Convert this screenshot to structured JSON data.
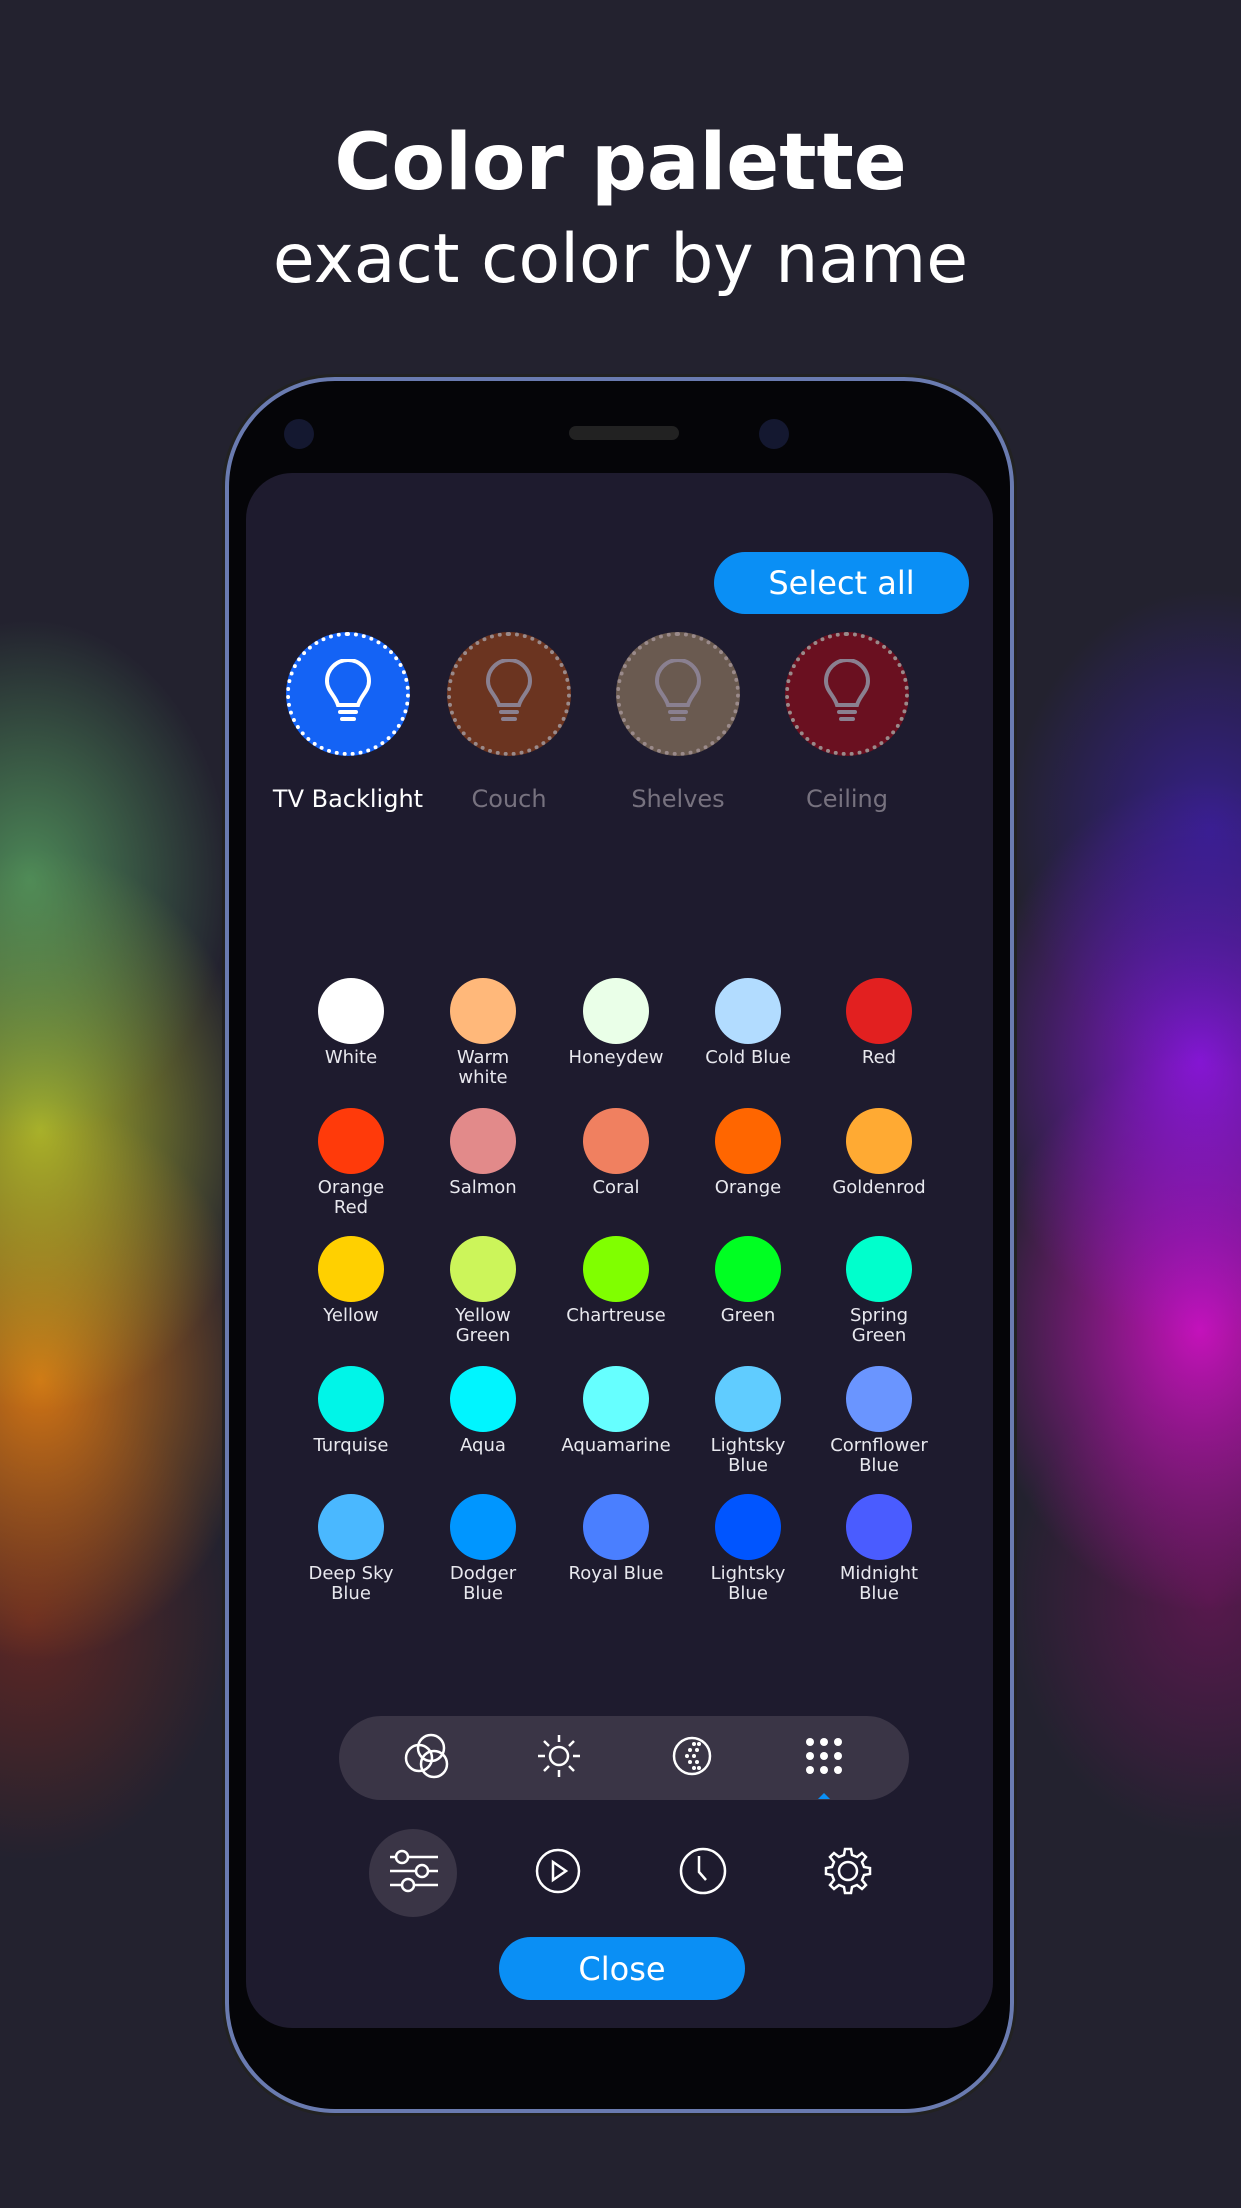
{
  "header": {
    "title": "Color palette",
    "subtitle": "exact color by name"
  },
  "toolbar": {
    "select_all": "Select all",
    "close": "Close"
  },
  "lights": [
    {
      "label": "TV Backlight",
      "color": "#1463f5",
      "selected": true
    },
    {
      "label": "Couch",
      "color": "#6b3420",
      "selected": false
    },
    {
      "label": "Shelves",
      "color": "#6a5a50",
      "selected": false
    },
    {
      "label": "Ceiling",
      "color": "#6a1020",
      "selected": false
    }
  ],
  "colors": [
    {
      "name": "White",
      "hex": "#ffffff"
    },
    {
      "name": "Warm\nwhite",
      "hex": "#ffb87a"
    },
    {
      "name": "Honeydew",
      "hex": "#eaffe8"
    },
    {
      "name": "Cold Blue",
      "hex": "#b2dcff"
    },
    {
      "name": "Red",
      "hex": "#e22020"
    },
    {
      "name": "Orange\nRed",
      "hex": "#ff3a0a"
    },
    {
      "name": "Salmon",
      "hex": "#e28a8a"
    },
    {
      "name": "Coral",
      "hex": "#f08060"
    },
    {
      "name": "Orange",
      "hex": "#ff6600"
    },
    {
      "name": "Goldenrod",
      "hex": "#ffaa33"
    },
    {
      "name": "Yellow",
      "hex": "#ffd000"
    },
    {
      "name": "Yellow\nGreen",
      "hex": "#ccf55a"
    },
    {
      "name": "Chartreuse",
      "hex": "#80ff00"
    },
    {
      "name": "Green",
      "hex": "#00ff22"
    },
    {
      "name": "Spring\nGreen",
      "hex": "#00ffcc"
    },
    {
      "name": "Turquise",
      "hex": "#00f5e8"
    },
    {
      "name": "Aqua",
      "hex": "#00f5ff"
    },
    {
      "name": "Aquamarine",
      "hex": "#66ffff"
    },
    {
      "name": "Lightsky\nBlue",
      "hex": "#60ccff"
    },
    {
      "name": "Cornflower\nBlue",
      "hex": "#6a95ff"
    },
    {
      "name": "Deep Sky\nBlue",
      "hex": "#4ab8ff"
    },
    {
      "name": "Dodger\nBlue",
      "hex": "#0096ff"
    },
    {
      "name": "Royal Blue",
      "hex": "#4a7fff"
    },
    {
      "name": "Lightsky\nBlue",
      "hex": "#0055ff"
    },
    {
      "name": "Midnight\nBlue",
      "hex": "#4a5cff"
    }
  ],
  "mode_tabs": [
    {
      "icon": "color-circles-icon"
    },
    {
      "icon": "brightness-icon"
    },
    {
      "icon": "temperature-icon"
    },
    {
      "icon": "palette-grid-icon",
      "active": true
    }
  ],
  "nav_tabs": [
    {
      "icon": "sliders-icon",
      "active": true
    },
    {
      "icon": "play-icon"
    },
    {
      "icon": "clock-icon"
    },
    {
      "icon": "gear-icon"
    }
  ],
  "accent": "#0a8ff5"
}
